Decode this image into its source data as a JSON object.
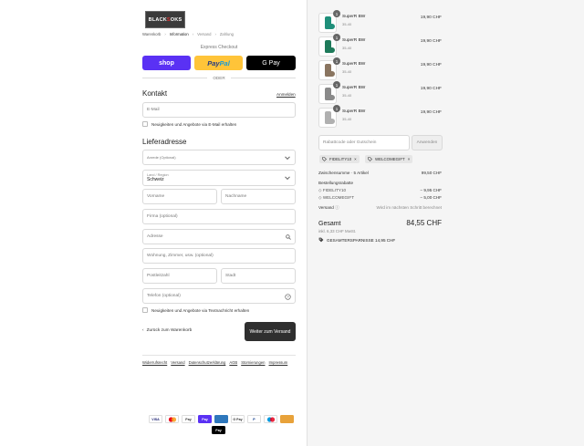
{
  "brand": {
    "logo_pre": "BLACK",
    "logo_mid": "S",
    "logo_post": "OKS"
  },
  "breadcrumbs": [
    "Warenkorb",
    "Information",
    "Versand",
    "Zahlung"
  ],
  "express": {
    "title": "Express Checkout",
    "shop": "shop",
    "paypal_a": "Pay",
    "paypal_b": "Pal",
    "gpay": "G Pay",
    "or": "ODER"
  },
  "contact": {
    "title": "Kontakt",
    "login": "Anmelden",
    "email_placeholder": "E-Mail",
    "newsletter": "Neuigkeiten und Angebote via E-Mail erhalten"
  },
  "shipping": {
    "title": "Lieferadresse",
    "salutation": "Anrede (Optional)",
    "country_label": "Land / Region",
    "country_value": "Schweiz",
    "first_name": "Vorname",
    "last_name": "Nachname",
    "company": "Firma (optional)",
    "address": "Adresse",
    "apartment": "Wohnung, Zimmer, usw. (optional)",
    "zip": "Postleitzahl",
    "city": "Stadt",
    "phone": "Telefon (optional)",
    "sms": "Neuigkeiten und Angebote via Textnachricht erhalten"
  },
  "nav": {
    "back": "Zurück zum Warenkorb",
    "continue": "Weiter zum Versand"
  },
  "footer_links": [
    "Widerrufsrecht",
    "Versand",
    "Datenschutzerklärung",
    "AGB",
    "Stornierungen",
    "Impressum"
  ],
  "payment_icons": [
    "VISA",
    "MC",
    "Pay",
    "G Pay",
    "AMEX",
    "G Pay",
    "P",
    "MC",
    "TWINT",
    "Pay"
  ],
  "colors": {
    "shop": "#5a31f4",
    "paypal": "#ffc439",
    "cta": "#2f2f2f",
    "summary_bg": "#f5f5f5"
  },
  "items": [
    {
      "qty": "1",
      "name": "SuperR BW",
      "variant": "35-40",
      "price": "19,90 CHF",
      "sock_color": "#1f8f7a"
    },
    {
      "qty": "1",
      "name": "SuperR BW",
      "variant": "35-40",
      "price": "19,90 CHF",
      "sock_color": "#1e7a5a"
    },
    {
      "qty": "1",
      "name": "SuperR BW",
      "variant": "35-40",
      "price": "19,90 CHF",
      "sock_color": "#8a7560"
    },
    {
      "qty": "1",
      "name": "SuperR BW",
      "variant": "35-40",
      "price": "19,90 CHF",
      "sock_color": "#8a8a8a"
    },
    {
      "qty": "1",
      "name": "SuperR BW",
      "variant": "35-40",
      "price": "19,90 CHF",
      "sock_color": "#b0b0b0"
    }
  ],
  "discount": {
    "placeholder": "Rabattcode oder Gutschein",
    "apply": "Anwenden",
    "codes": [
      "FIDELITY10",
      "WELCOMEGIFT"
    ]
  },
  "summary": {
    "subtotal_label": "Zwischensumme · 5 Artikel",
    "subtotal": "99,50 CHF",
    "discounts_label": "Bestellungsrabatte",
    "d1_label": "FIDELITY10",
    "d1": "− 9,95 CHF",
    "d2_label": "WELCOMEGIFT",
    "d2": "− 5,00 CHF",
    "shipping_label": "Versand",
    "shipping_value": "Wird im nächsten Schritt berechnet",
    "total_label": "Gesamt",
    "total": "84,55 CHF",
    "tax": "inkl. 6,33 CHF MwSt.",
    "savings": "GESAMTERSPARNISSE 14,95 CHF"
  }
}
